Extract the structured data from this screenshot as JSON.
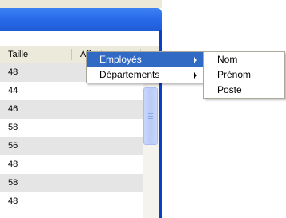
{
  "table": {
    "columns": [
      "Taille",
      "Affect…"
    ],
    "rows": [
      "48",
      "44",
      "46",
      "58",
      "56",
      "48",
      "58",
      "48"
    ]
  },
  "context_menu": {
    "items": [
      {
        "label": "Employés",
        "has_submenu": true,
        "selected": true
      },
      {
        "label": "Départements",
        "has_submenu": true,
        "selected": false
      }
    ]
  },
  "submenu": {
    "items": [
      "Nom",
      "Prénom",
      "Poste"
    ]
  },
  "colors": {
    "title_blue": "#2a6bea",
    "menu_highlight": "#316ac5",
    "row_alt": "#e5e5e5"
  }
}
